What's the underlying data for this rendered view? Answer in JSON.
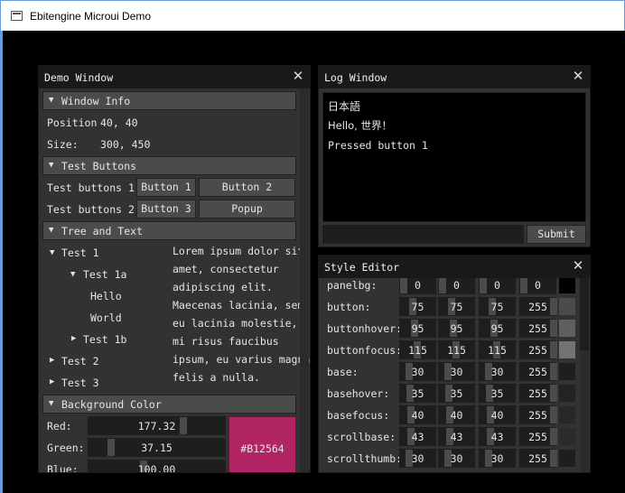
{
  "app": {
    "title": "Ebitengine Microui Demo"
  },
  "demo": {
    "title": "Demo Window",
    "window_info": {
      "header": "Window Info",
      "position_label": "Position",
      "position_value": "40, 40",
      "size_label": "Size:",
      "size_value": "300, 450"
    },
    "test_buttons": {
      "header": "Test Buttons",
      "row1_label": "Test buttons 1:",
      "row2_label": "Test buttons 2:",
      "button1": "Button 1",
      "button2": "Button 2",
      "button3": "Button 3",
      "popup": "Popup"
    },
    "tree": {
      "header": "Tree and Text",
      "test1": "Test 1",
      "test1a": "Test 1a",
      "hello": "Hello",
      "world": "World",
      "test1b": "Test 1b",
      "test2": "Test 2",
      "test3": "Test 3",
      "lorem_lines": [
        "Lorem ipsum dolor sit",
        "amet, consectetur",
        "adipiscing elit.",
        "Maecenas lacinia, sem",
        "eu lacinia molestie,",
        "mi risus faucibus",
        "ipsum, eu varius magna",
        "felis a nulla."
      ]
    },
    "background": {
      "header": "Background Color",
      "red_label": "Red:",
      "red_value": "177.32",
      "green_label": "Green:",
      "green_value": "37.15",
      "blue_label": "Blue:",
      "blue_value": "100.00",
      "hex": "#B12564",
      "hex_color": "#B12564"
    }
  },
  "log": {
    "title": "Log Window",
    "lines": [
      "日本語",
      "Hello, 世界！",
      "Pressed button 1"
    ],
    "input_value": "",
    "submit": "Submit"
  },
  "style_editor": {
    "title": "Style Editor",
    "rows": [
      {
        "label": "panelbg:",
        "values": [
          "0",
          "0",
          "0",
          "0"
        ],
        "swatch": "#000000"
      },
      {
        "label": "button:",
        "values": [
          "75",
          "75",
          "75",
          "255"
        ],
        "swatch": "#4B4B4B"
      },
      {
        "label": "buttonhover:",
        "values": [
          "95",
          "95",
          "95",
          "255"
        ],
        "swatch": "#5F5F5F"
      },
      {
        "label": "buttonfocus:",
        "values": [
          "115",
          "115",
          "115",
          "255"
        ],
        "swatch": "#737373"
      },
      {
        "label": "base:",
        "values": [
          "30",
          "30",
          "30",
          "255"
        ],
        "swatch": "#1E1E1E"
      },
      {
        "label": "basehover:",
        "values": [
          "35",
          "35",
          "35",
          "255"
        ],
        "swatch": "#232323"
      },
      {
        "label": "basefocus:",
        "values": [
          "40",
          "40",
          "40",
          "255"
        ],
        "swatch": "#282828"
      },
      {
        "label": "scrollbase:",
        "values": [
          "43",
          "43",
          "43",
          "255"
        ],
        "swatch": "#2B2B2B"
      },
      {
        "label": "scrollthumb:",
        "values": [
          "30",
          "30",
          "30",
          "255"
        ],
        "swatch": "#1E1E1E"
      }
    ]
  }
}
